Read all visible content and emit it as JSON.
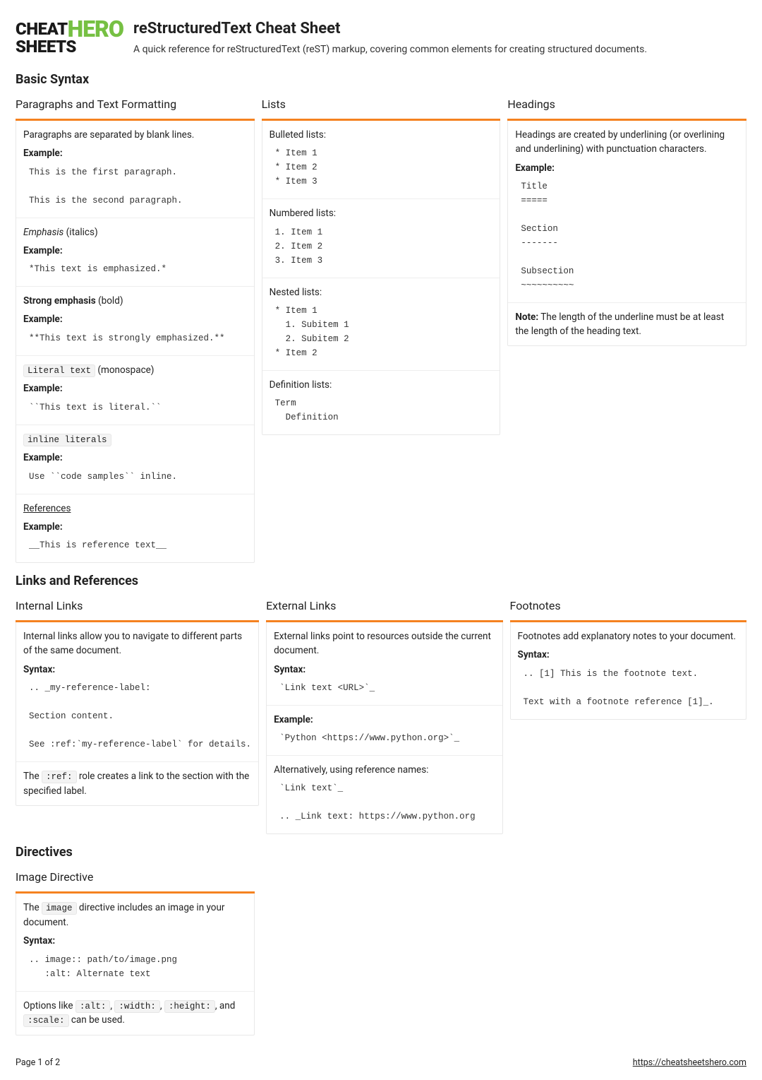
{
  "logo": {
    "l1a": "CHEAT",
    "l1b": "HERO",
    "l2": "SHEETS"
  },
  "header": {
    "title": "reStructuredText Cheat Sheet",
    "subtitle": "A quick reference for reStructuredText (reST) markup, covering common elements for creating structured documents."
  },
  "basic": {
    "title": "Basic Syntax",
    "para": {
      "title": "Paragraphs and Text Formatting",
      "s1_text": "Paragraphs are separated by blank lines.",
      "ex": "Example:",
      "s1_code": "This is the first paragraph.\n\nThis is the second paragraph.",
      "s2_text1": "Emphasis",
      "s2_text2": " (italics)",
      "s2_code": "*This text is emphasized.*",
      "s3_text1": "Strong emphasis",
      "s3_text2": " (bold)",
      "s3_code": "**This text is strongly emphasized.**",
      "s4_code1": "Literal text",
      "s4_text2": " (monospace)",
      "s4_code": "``This text is literal.``",
      "s5_code1": "inline literals",
      "s5_code": "Use ``code samples`` inline.",
      "s6_text": "References",
      "s6_code": "__This is reference text__"
    },
    "lists": {
      "title": "Lists",
      "s1_text": "Bulleted lists:",
      "s1_code": "* Item 1\n* Item 2\n* Item 3",
      "s2_text": "Numbered lists:",
      "s2_code": "1. Item 1\n2. Item 2\n3. Item 3",
      "s3_text": "Nested lists:",
      "s3_code": "* Item 1\n  1. Subitem 1\n  2. Subitem 2\n* Item 2",
      "s4_text": "Definition lists:",
      "s4_code": "Term\n  Definition"
    },
    "headings": {
      "title": "Headings",
      "s1_text": "Headings are created by underlining (or overlining and underlining) with punctuation characters.",
      "s1_code": "Title\n=====\n\nSection\n-------\n\nSubsection\n~~~~~~~~~~",
      "note_b": "Note:",
      "note_t": " The length of the underline must be at least the length of the heading text."
    }
  },
  "links": {
    "title": "Links and References",
    "internal": {
      "title": "Internal Links",
      "s1_text": "Internal links allow you to navigate to different parts of the same document.",
      "syn": "Syntax:",
      "s1_code": ".. _my-reference-label:\n\nSection content.\n\nSee :ref:`my-reference-label` for details.",
      "s2_t1": "The ",
      "s2_c1": ":ref:",
      "s2_t2": " role creates a link to the section with the specified label."
    },
    "external": {
      "title": "External Links",
      "s1_text": "External links point to resources outside the current document.",
      "s1_code": "`Link text <URL>`_",
      "ex": "Example:",
      "s2_code": "`Python <https://www.python.org>`_",
      "s3_text": "Alternatively, using reference names:",
      "s3_code": "`Link text`_\n\n.. _Link text: https://www.python.org"
    },
    "footnotes": {
      "title": "Footnotes",
      "s1_text": "Footnotes add explanatory notes to your document.",
      "s1_code": ".. [1] This is the footnote text.\n\nText with a footnote reference [1]_."
    }
  },
  "directives": {
    "title": "Directives",
    "image": {
      "title": "Image Directive",
      "s1_t1": "The ",
      "s1_c1": "image",
      "s1_t2": " directive includes an image in your document.",
      "syn": "Syntax:",
      "s1_code": ".. image:: path/to/image.png\n   :alt: Alternate text",
      "s2_t1": "Options like ",
      "s2_c1": ":alt:",
      "s2_t2": ", ",
      "s2_c2": ":width:",
      "s2_t3": ", ",
      "s2_c3": ":height:",
      "s2_t4": ", and ",
      "s2_c4": ":scale:",
      "s2_t5": " can be used."
    }
  },
  "footer": {
    "page": "Page 1 of 2",
    "url": "https://cheatsheetshero.com"
  }
}
